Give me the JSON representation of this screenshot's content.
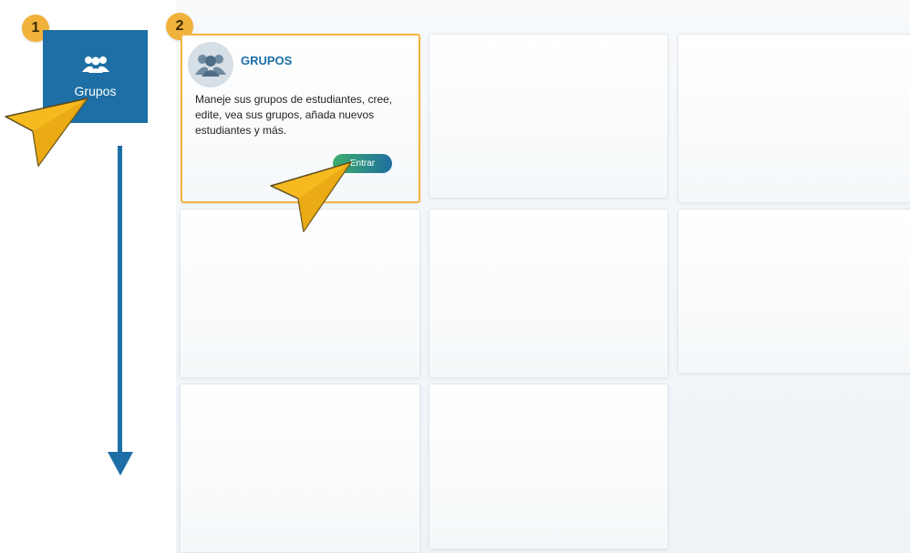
{
  "steps": {
    "step1": "1",
    "step2": "2"
  },
  "sidebar": {
    "tile_label": "Grupos",
    "tile_icon": "users-icon"
  },
  "card": {
    "title": "GRUPOS",
    "description": "Maneje sus grupos de estudiantes, cree, edite, vea sus grupos, añada nuevos estudiantes y más.",
    "button_label": "Entrar",
    "icon": "group-avatar-icon"
  },
  "colors": {
    "primary": "#1d6fa5",
    "badge": "#f0b23a",
    "highlight_border": "#f2b441",
    "button_gradient_start": "#3dae6b",
    "button_gradient_end": "#1f6fa0",
    "cursor": "#f6b91f"
  }
}
